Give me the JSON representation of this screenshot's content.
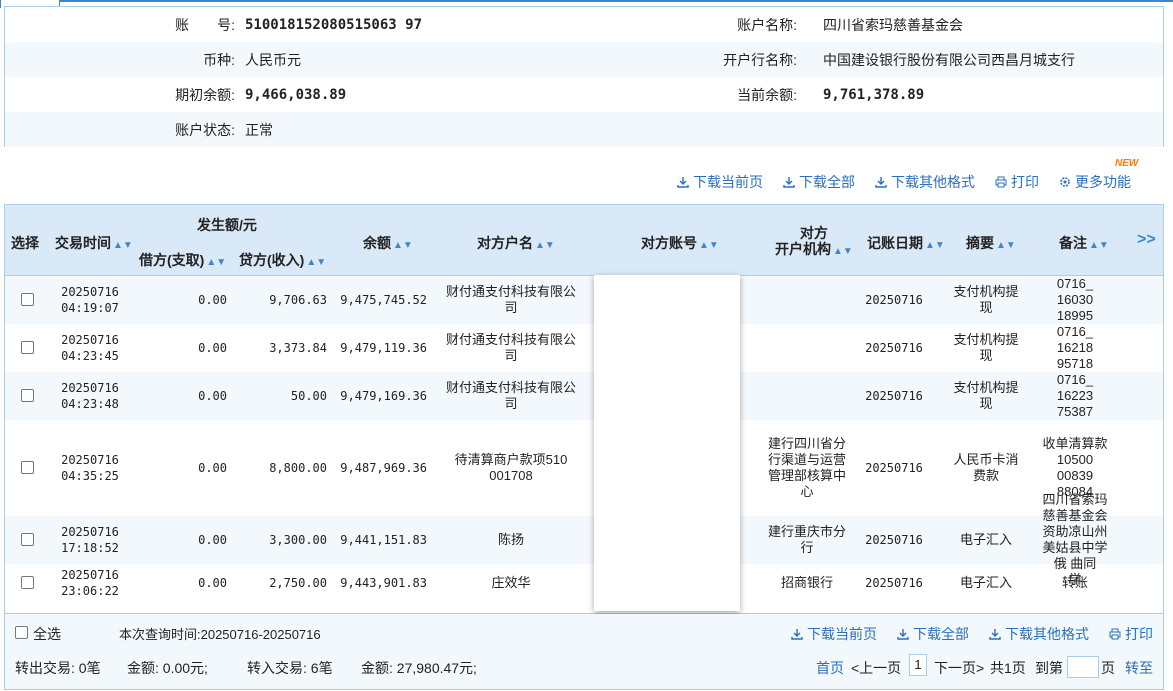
{
  "account": {
    "account_no_label": "账　　号:",
    "account_no": "510018152080515063 97",
    "account_name_label": "账户名称:",
    "account_name": "四川省索玛慈善基金会",
    "currency_label": "币种:",
    "currency": "人民币元",
    "bank_label": "开户行名称:",
    "bank": "中国建设银行股份有限公司西昌月城支行",
    "opening_balance_label": "期初余额:",
    "opening_balance": "9,466,038.89",
    "current_balance_label": "当前余额:",
    "current_balance": "9,761,378.89",
    "status_label": "账户状态:",
    "status": "正常"
  },
  "toolbar": {
    "download_page": "下载当前页",
    "download_all": "下载全部",
    "download_other": "下载其他格式",
    "print": "打印",
    "more": "更多功能",
    "new_badge": "NEW"
  },
  "table": {
    "headers": {
      "select": "选择",
      "time": "交易时间",
      "amount_group": "发生额/元",
      "debit": "借方(支取)",
      "credit": "贷方(收入)",
      "balance": "余额",
      "party_name": "对方户名",
      "party_account": "对方账号",
      "party_bank_l1": "对方",
      "party_bank_l2": "开户机构",
      "post_date": "记账日期",
      "summary": "摘要",
      "remark": "备注",
      "more": ">>"
    },
    "rows": [
      {
        "date": "20250716",
        "time": "04:19:07",
        "debit": "0.00",
        "credit": "9,706.63",
        "balance": "9,475,745.52",
        "party": [
          "财付通支付科技有限公",
          "司"
        ],
        "bank": [],
        "post_date": "20250716",
        "summary": [
          "支付机构提",
          "现"
        ],
        "remark": [
          "0716_",
          "16030",
          "18995"
        ]
      },
      {
        "date": "20250716",
        "time": "04:23:45",
        "debit": "0.00",
        "credit": "3,373.84",
        "balance": "9,479,119.36",
        "party": [
          "财付通支付科技有限公",
          "司"
        ],
        "bank": [],
        "post_date": "20250716",
        "summary": [
          "支付机构提",
          "现"
        ],
        "remark": [
          "0716_",
          "16218",
          "95718"
        ]
      },
      {
        "date": "20250716",
        "time": "04:23:48",
        "debit": "0.00",
        "credit": "50.00",
        "balance": "9,479,169.36",
        "party": [
          "财付通支付科技有限公",
          "司"
        ],
        "bank": [],
        "post_date": "20250716",
        "summary": [
          "支付机构提",
          "现"
        ],
        "remark": [
          "0716_",
          "16223",
          "75387"
        ]
      },
      {
        "date": "20250716",
        "time": "04:35:25",
        "debit": "0.00",
        "credit": "8,800.00",
        "balance": "9,487,969.36",
        "party": [
          "待清算商户款项510",
          "001708"
        ],
        "bank": [
          "建行四川省分",
          "行渠道与运营",
          "管理部核算中",
          "心"
        ],
        "post_date": "20250716",
        "summary": [
          "人民币卡消",
          "费款"
        ],
        "remark": [
          "收单清算款",
          "10500",
          "00839",
          "88084"
        ]
      },
      {
        "date": "20250716",
        "time": "17:18:52",
        "debit": "0.00",
        "credit": "3,300.00",
        "balance": "9,441,151.83",
        "party": [
          "陈扬"
        ],
        "bank": [
          "建行重庆市分",
          "行"
        ],
        "post_date": "20250716",
        "summary": [
          "电子汇入"
        ],
        "remark": [
          "四川省索玛",
          "慈善基金会",
          "资助凉山州",
          "美姑县中学",
          "俄 曲同",
          "学"
        ]
      },
      {
        "date": "20250716",
        "time": "23:06:22",
        "debit": "0.00",
        "credit": "2,750.00",
        "balance": "9,443,901.83",
        "party": [
          "庄效华"
        ],
        "bank": [
          "招商银行"
        ],
        "post_date": "20250716",
        "summary": [
          "电子汇入"
        ],
        "remark": [
          "转账"
        ]
      }
    ]
  },
  "footer": {
    "select_all": "全选",
    "query_time": "本次查询时间:20250716-20250716",
    "download_page": "下载当前页",
    "download_all": "下载全部",
    "download_other": "下载其他格式",
    "print": "打印",
    "out_tx": "转出交易: 0笔",
    "out_amount": "金额: 0.00元;",
    "in_tx": "转入交易: 6笔",
    "in_amount": "金额: 27,980.47元;",
    "first": "首页",
    "prev": "<上一页",
    "page": "1",
    "next": "下一页>",
    "total": "共1页",
    "goto_prefix": "到第",
    "goto_suffix": "页",
    "go": "转至"
  }
}
